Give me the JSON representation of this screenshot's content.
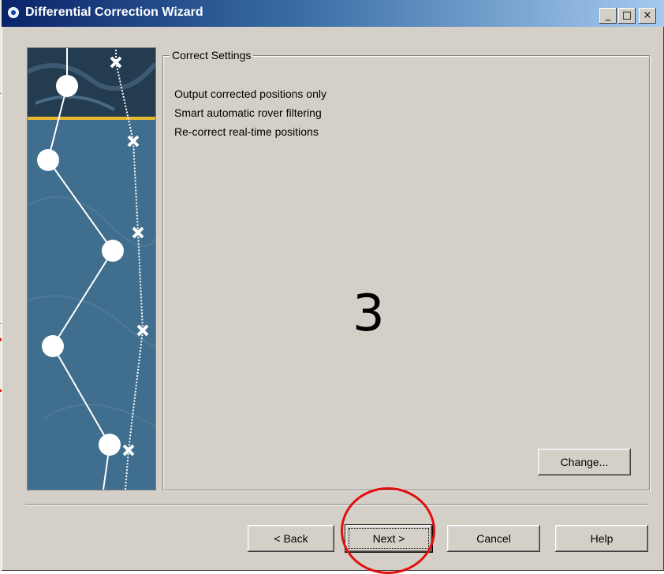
{
  "window": {
    "title": "Differential Correction Wizard",
    "controls": {
      "minimize": "_",
      "maximize": "□",
      "close": "×"
    }
  },
  "group": {
    "title": "Correct Settings",
    "settings": [
      "Output corrected positions only",
      "Smart automatic rover filtering",
      "Re-correct real-time positions"
    ],
    "change_label": "Change..."
  },
  "overlay": {
    "step_number": "3"
  },
  "footer": {
    "back_label": "< Back",
    "next_label": "Next >",
    "cancel_label": "Cancel",
    "help_label": "Help"
  },
  "colors": {
    "dialog_bg": "#d4d0c8",
    "titlebar_start": "#0a246a",
    "titlebar_end": "#a6caf0",
    "annotation": "#e01010",
    "image_band": "#e8b830"
  }
}
